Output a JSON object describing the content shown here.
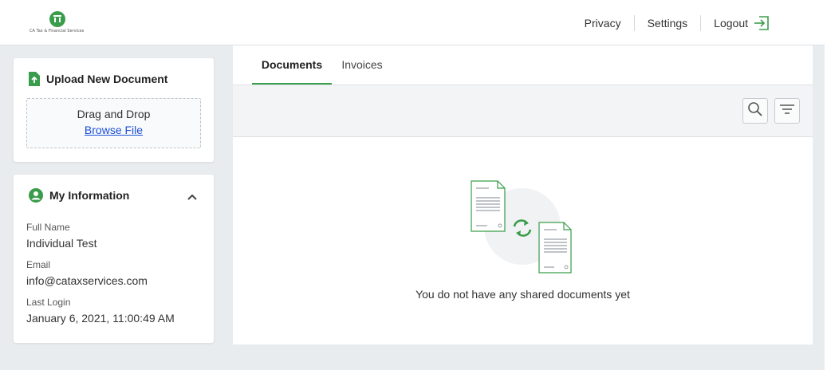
{
  "header": {
    "logo_text": "CA Tax & Financial Services",
    "nav": {
      "privacy": "Privacy",
      "settings": "Settings",
      "logout": "Logout"
    },
    "icons": {
      "logout": "logout-icon"
    }
  },
  "colors": {
    "accent": "#3a9d4b",
    "link": "#1a4fd6"
  },
  "upload": {
    "title": "Upload New Document",
    "drag_text": "Drag and Drop",
    "browse_link": "Browse File"
  },
  "info": {
    "title": "My Information",
    "fields": [
      {
        "label": "Full Name",
        "value": "Individual Test"
      },
      {
        "label": "Email",
        "value": "info@cataxservices.com"
      },
      {
        "label": "Last Login",
        "value": "January 6, 2021, 11:00:49 AM"
      }
    ]
  },
  "main": {
    "tabs": [
      {
        "label": "Documents",
        "active": true
      },
      {
        "label": "Invoices",
        "active": false
      }
    ],
    "empty_text": "You do not have any shared documents yet"
  }
}
